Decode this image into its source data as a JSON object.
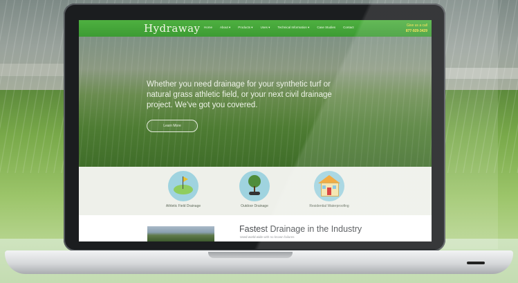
{
  "site": {
    "logo": "Hydraway",
    "nav": [
      "Home",
      "About  ▾",
      "Products  ▾",
      "Uses  ▾",
      "Technical Information  ▾",
      "Case Studies",
      "Contact"
    ],
    "call_label": "Give us a call",
    "phone": "877-929-3429"
  },
  "hero": {
    "headline": "Whether you need drainage for your synthetic turf or natural grass athletic field, or your next civil drainage project. We've got you covered.",
    "button": "Learn More"
  },
  "services": [
    {
      "label": "Athletic Field Drainage",
      "icon": "golf-flag-icon"
    },
    {
      "label": "Outdoor Drainage",
      "icon": "tree-pipe-icon"
    },
    {
      "label": "Residential Waterproofing",
      "icon": "house-icon"
    }
  ],
  "feature": {
    "title": "Fastest Drainage in the Industry",
    "subtitle": "Used world wide with no known failures"
  },
  "colors": {
    "brand_green": "#46a83b",
    "phone_yellow": "#ffe24a"
  }
}
